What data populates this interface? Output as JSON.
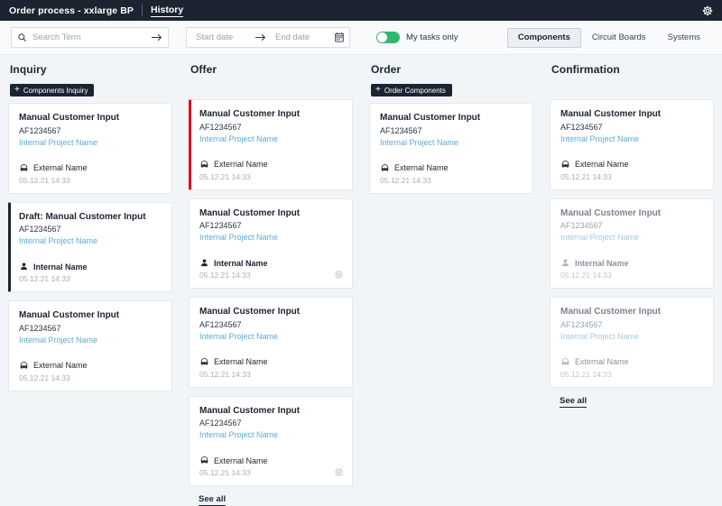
{
  "header": {
    "title": "Order process - xxlarge BP",
    "history_label": "History",
    "settings_icon": "gear-icon"
  },
  "filters": {
    "search": {
      "placeholder": "Search Term",
      "value": "",
      "icon": "search-icon",
      "submit_icon": "arrow-right-icon"
    },
    "date_range": {
      "start_placeholder": "Start date",
      "end_placeholder": "End date",
      "separator_icon": "arrow-right-icon",
      "calendar_icon": "calendar-icon"
    },
    "my_tasks_toggle": {
      "label": "My tasks only",
      "on": true,
      "color": "#2eb872"
    },
    "view_tabs": [
      {
        "label": "Components",
        "active": true
      },
      {
        "label": "Circuit Boards",
        "active": false
      },
      {
        "label": "Systems",
        "active": false
      }
    ]
  },
  "colors": {
    "header_bg": "#1b2430",
    "page_bg": "#f2f5f8",
    "accent_red": "#e3001b",
    "accent_dark": "#1b2430",
    "toggle_green": "#2eb872",
    "link_blue": "#5fa8d8"
  },
  "columns": [
    {
      "title": "Inquiry",
      "action_label": "Components Inquiry",
      "has_action": true,
      "see_all": null,
      "cards": [
        {
          "title": "Manual Customer Input",
          "reference": "AF1234567",
          "project": "Internal Project Name",
          "contact_icon": "headset-icon",
          "contact": "External Name",
          "contact_bold": false,
          "date": "05.12.21 14:33",
          "accent": "none",
          "muted": false,
          "badge": null
        },
        {
          "title": "Draft: Manual Customer Input",
          "reference": "AF1234567",
          "project": "Internal Project Name",
          "contact_icon": "person-icon",
          "contact": "Internal Name",
          "contact_bold": true,
          "date": "05.12.21 14:33",
          "accent": "dark",
          "muted": false,
          "badge": null
        },
        {
          "title": "Manual Customer Input",
          "reference": "AF1234567",
          "project": "Internal Project Name",
          "contact_icon": "headset-icon",
          "contact": "External Name",
          "contact_bold": false,
          "date": "05.12.21 14:33",
          "accent": "none",
          "muted": false,
          "badge": null
        }
      ]
    },
    {
      "title": "Offer",
      "action_label": null,
      "has_action": false,
      "see_all": "See all",
      "cards": [
        {
          "title": "Manual Customer Input",
          "reference": "AF1234567",
          "project": "Internal Project Name",
          "contact_icon": "headset-icon",
          "contact": "External Name",
          "contact_bold": false,
          "date": "05.12.21 14:33",
          "accent": "red",
          "muted": false,
          "badge": null
        },
        {
          "title": "Manual Customer Input",
          "reference": "AF1234567",
          "project": "Internal Project Name",
          "contact_icon": "person-icon",
          "contact": "Internal Name",
          "contact_bold": true,
          "date": "05.12.21 14:33",
          "accent": "none",
          "muted": false,
          "badge": "chip-badge"
        },
        {
          "title": "Manual Customer Input",
          "reference": "AF1234567",
          "project": "Internal Project Name",
          "contact_icon": "headset-icon",
          "contact": "External Name",
          "contact_bold": false,
          "date": "05.12.21 14:33",
          "accent": "none",
          "muted": false,
          "badge": null
        },
        {
          "title": "Manual Customer Input",
          "reference": "AF1234567",
          "project": "Internal Project Name",
          "contact_icon": "headset-icon",
          "contact": "External Name",
          "contact_bold": false,
          "date": "05.12.21 14:33",
          "accent": "none",
          "muted": false,
          "badge": "chip-badge"
        }
      ]
    },
    {
      "title": "Order",
      "action_label": "Order Components",
      "has_action": true,
      "see_all": null,
      "cards": [
        {
          "title": "Manual Customer Input",
          "reference": "AF1234567",
          "project": "Internal Project Name",
          "contact_icon": "headset-icon",
          "contact": "External Name",
          "contact_bold": false,
          "date": "05.12.21 14:33",
          "accent": "none",
          "muted": false,
          "badge": null
        }
      ]
    },
    {
      "title": "Confirmation",
      "action_label": null,
      "has_action": false,
      "see_all": "See all",
      "cards": [
        {
          "title": "Manual Customer Input",
          "reference": "AF1234567",
          "project": "Internal Project Name",
          "contact_icon": "headset-icon",
          "contact": "External Name",
          "contact_bold": false,
          "date": "05.12.21 14:33",
          "accent": "none",
          "muted": false,
          "badge": null
        },
        {
          "title": "Manual Customer Input",
          "reference": "AF1234567",
          "project": "Internal Project Name",
          "contact_icon": "person-icon",
          "contact": "Internal Name",
          "contact_bold": true,
          "date": "05.12.21 14:33",
          "accent": "none",
          "muted": true,
          "badge": null
        },
        {
          "title": "Manual Customer Input",
          "reference": "AF1234567",
          "project": "Internal Project Name",
          "contact_icon": "headset-icon",
          "contact": "External Name",
          "contact_bold": false,
          "date": "05.12.21 14:33",
          "accent": "none",
          "muted": true,
          "badge": null
        }
      ]
    }
  ]
}
